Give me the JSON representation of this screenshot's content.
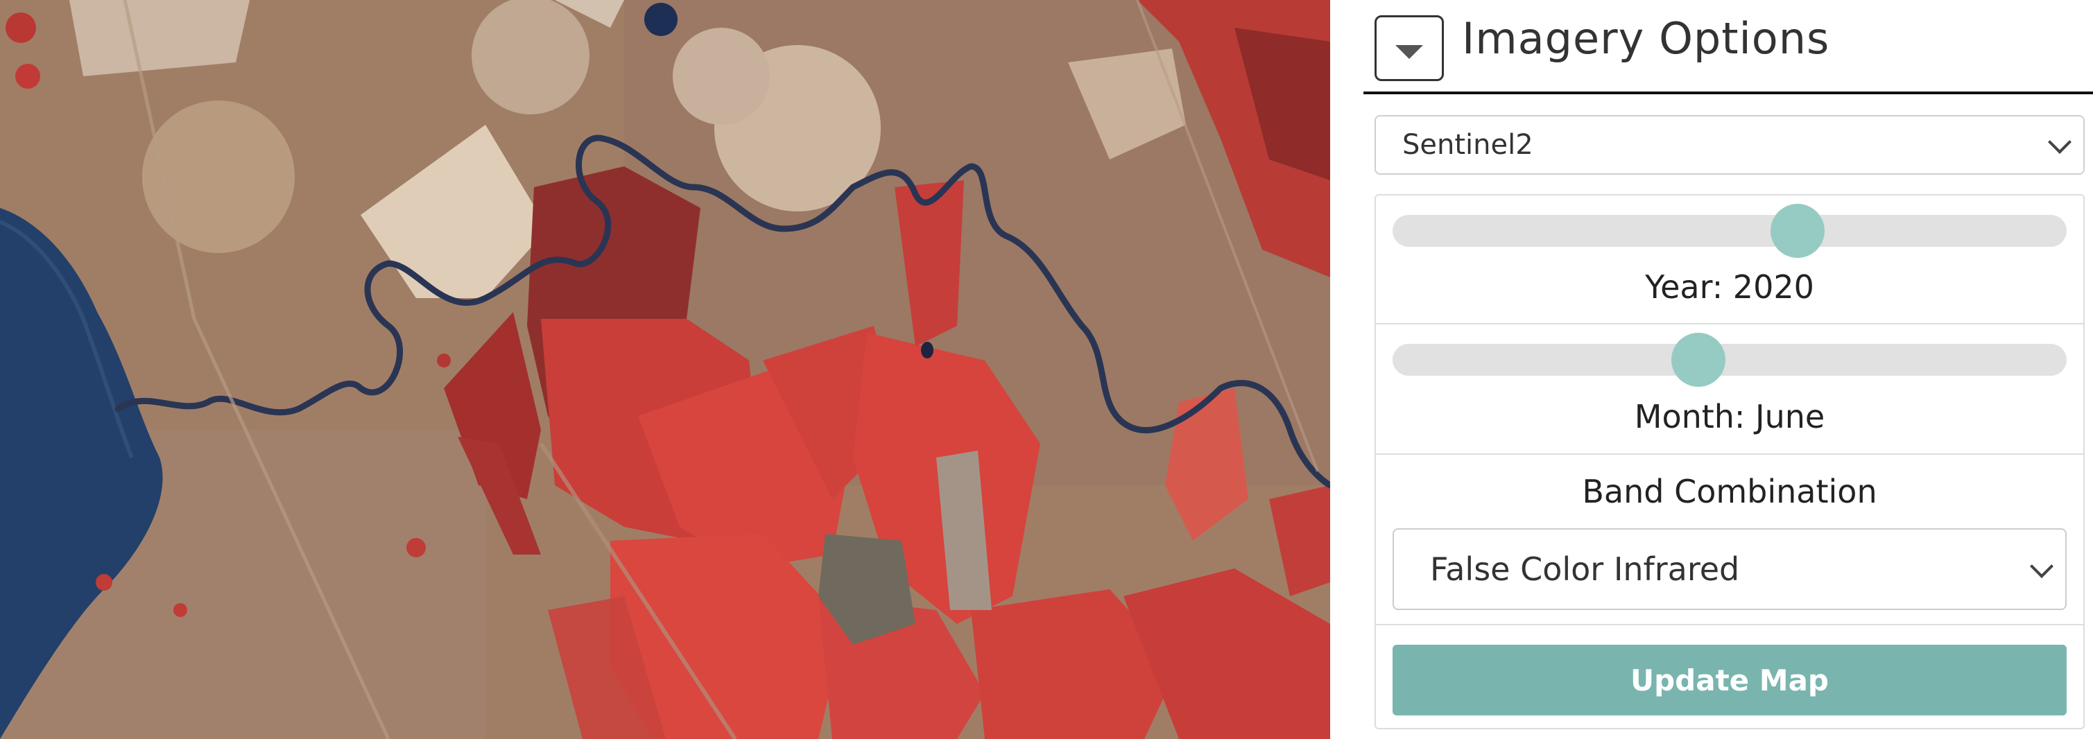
{
  "panel": {
    "title": "Imagery Options",
    "sensor_select": {
      "value": "Sentinel2"
    },
    "year_slider": {
      "label": "Year: 2020",
      "position": 0.61
    },
    "month_slider": {
      "label": "Month: June",
      "position": 0.45
    },
    "band_combination": {
      "label": "Band Combination",
      "value": "False Color Infrared"
    },
    "update_button": "Update Map"
  },
  "colors": {
    "accent": "#79b5ae",
    "slider_thumb": "#96cbc3",
    "vegetation_red": "#d9433c",
    "water": "#1f3a5c",
    "bare_ground": "#9c7a63"
  },
  "icons": {
    "collapse": "caret-down-icon",
    "select_chevron": "chevron-down-icon"
  }
}
